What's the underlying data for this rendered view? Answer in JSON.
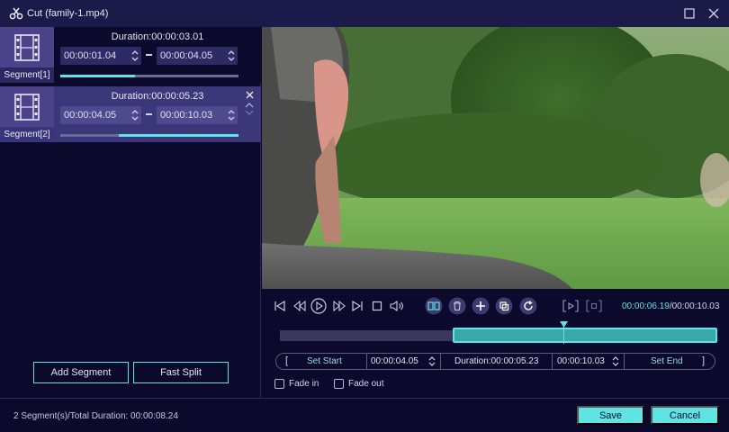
{
  "window": {
    "title": "Cut (family-1.mp4)",
    "icons": [
      "scissors-icon",
      "maximize-icon",
      "close-icon"
    ]
  },
  "segments": [
    {
      "label": "Segment[1]",
      "duration": "Duration:00:00:03.01",
      "start": "00:00:01.04",
      "end": "00:00:04.05",
      "progress": 0.42
    },
    {
      "label": "Segment[2]",
      "duration": "Duration:00:00:05.23",
      "start": "00:00:04.05",
      "end": "00:00:10.03",
      "progress": 0.6
    }
  ],
  "left_actions": {
    "add_segment": "Add Segment",
    "fast_split": "Fast Split"
  },
  "player": {
    "current_time": "00:00:06.19",
    "total_time": "/00:00:10.03",
    "selection_start": 0.4,
    "selection_end": 1.0,
    "playhead": 0.65
  },
  "time_bar": {
    "open_bracket": "[",
    "set_start": "Set Start",
    "start_value": "00:00:04.05",
    "duration": "Duration:00:00:05.23",
    "end_value": "00:00:10.03",
    "set_end": "Set End",
    "close_bracket": "]"
  },
  "options": {
    "fade_in": "Fade in",
    "fade_out": "Fade out"
  },
  "footer": {
    "summary": "2 Segment(s)/Total Duration: 00:00:08.24",
    "save": "Save",
    "cancel": "Cancel"
  },
  "colors": {
    "accent": "#5fe3e3",
    "background": "#0c0a2c",
    "selected_segment": "#3c3778"
  }
}
